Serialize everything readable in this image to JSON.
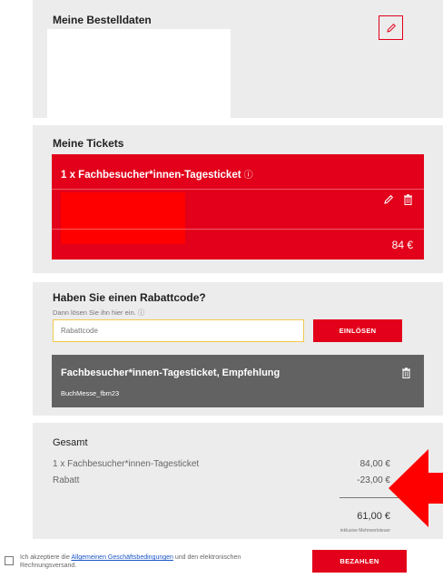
{
  "bestelldaten": {
    "title": "Meine Bestelldaten"
  },
  "tickets": {
    "title": "Meine Tickets",
    "ticket_name": "1 x Fachbesucher*innen-Tagesticket",
    "info_icon": "info-icon",
    "price": "84 €"
  },
  "rabatt": {
    "title": "Haben Sie einen Rabattcode?",
    "subtitle": "Dann lösen Sie ihn hier ein. ⓘ",
    "placeholder": "Rabattcode",
    "button": "EINLÖSEN",
    "coupon_title": "Fachbesucher*innen-Tagesticket, Empfehlung",
    "coupon_code": "BuchMesse_fbm23"
  },
  "gesamt": {
    "title": "Gesamt",
    "rows": [
      {
        "label": "1 x Fachbesucher*innen-Tagesticket",
        "value": "84,00 €"
      },
      {
        "label": "Rabatt",
        "value": "-23,00 €"
      }
    ],
    "total": "61,00 €",
    "tax_note": "inklusive Mehrwertsteuer"
  },
  "footer": {
    "terms_prefix": "Ich akzeptiere die ",
    "terms_link": "Allgemeinen Geschäftsbedingungen",
    "terms_suffix": " und den elektronischen Rechnungsversand.",
    "pay_button": "BEZAHLEN"
  },
  "colors": {
    "accent": "#e2001a",
    "panel": "#ececec",
    "coupon": "#626262"
  }
}
